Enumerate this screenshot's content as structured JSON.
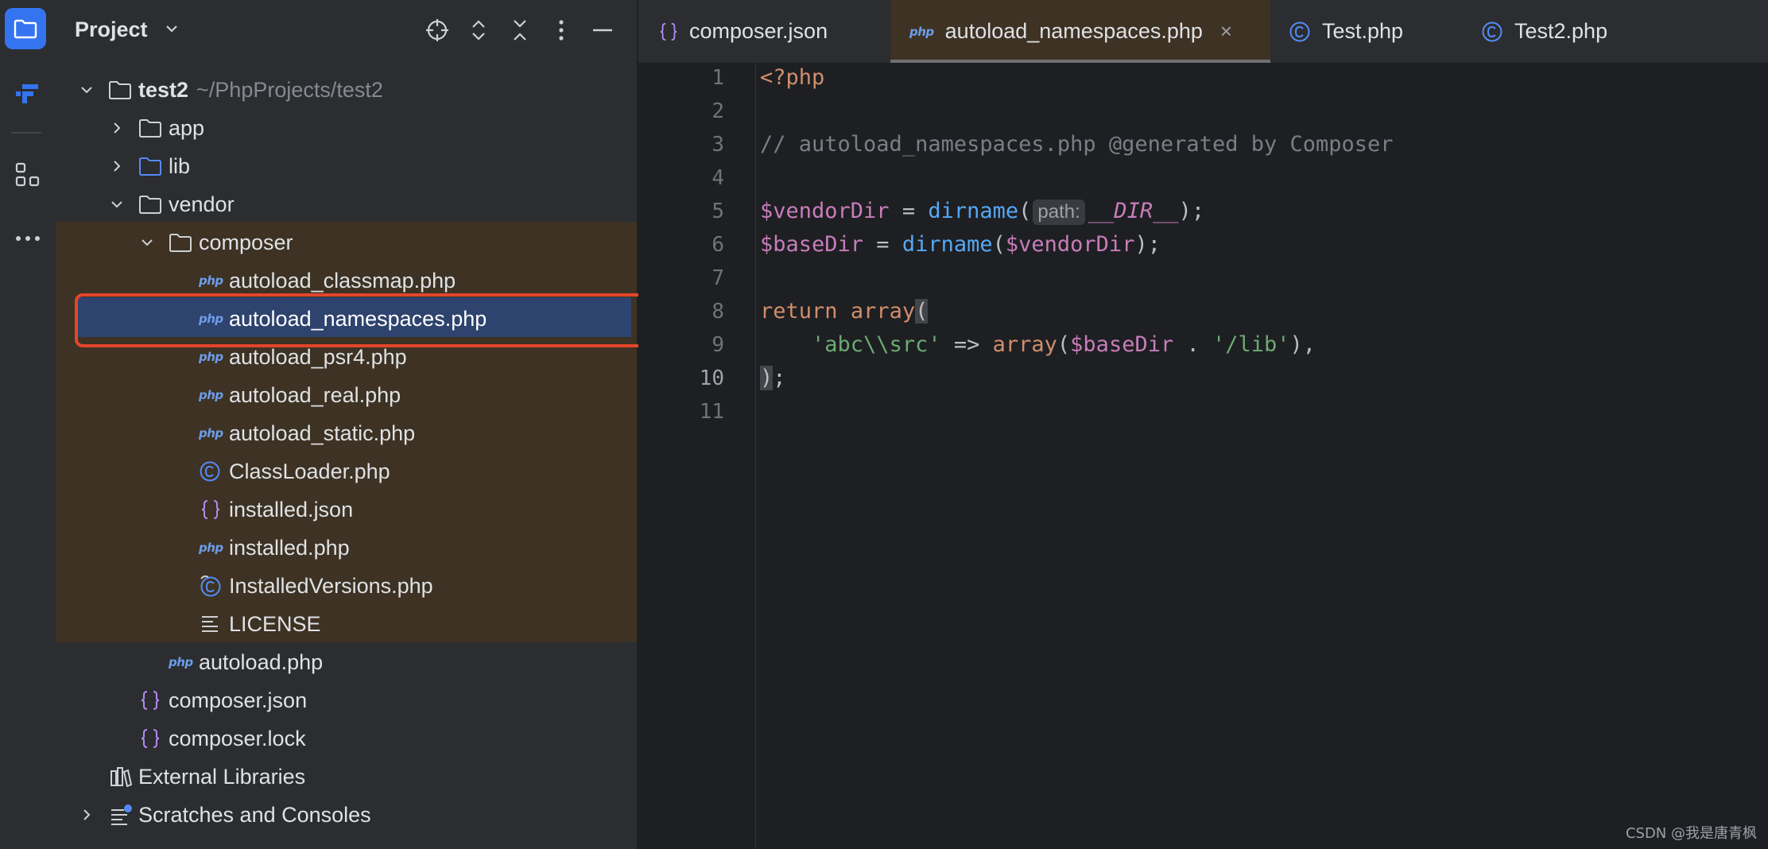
{
  "project": {
    "title": "Project",
    "tree": {
      "root": {
        "label": "test2",
        "path": "~/PhpProjects/test2"
      },
      "app": "app",
      "lib": "lib",
      "vendor": "vendor",
      "composer": "composer",
      "composer_files": [
        "autoload_classmap.php",
        "autoload_namespaces.php",
        "autoload_psr4.php",
        "autoload_real.php",
        "autoload_static.php",
        "ClassLoader.php",
        "installed.json",
        "installed.php",
        "InstalledVersions.php",
        "LICENSE"
      ],
      "vendor_autoload": "autoload.php",
      "root_files": [
        "composer.json",
        "composer.lock"
      ],
      "external_libraries": "External Libraries",
      "scratches": "Scratches and Consoles"
    }
  },
  "tabs": [
    {
      "label": "composer.json",
      "icon": "json-icon",
      "active": false
    },
    {
      "label": "autoload_namespaces.php",
      "icon": "php-file-icon",
      "active": true
    },
    {
      "label": "Test.php",
      "icon": "class-icon",
      "active": false
    },
    {
      "label": "Test2.php",
      "icon": "class-icon",
      "active": false
    }
  ],
  "php_tag": "php",
  "editor": {
    "line_numbers": [
      "1",
      "2",
      "3",
      "4",
      "5",
      "6",
      "7",
      "8",
      "9",
      "10",
      "11"
    ],
    "current_line": 10,
    "tokens": {
      "open_tag": "<?php",
      "comment": "// autoload_namespaces.php @generated by Composer",
      "vendor_dir_var": "$vendorDir",
      "assign": " = ",
      "dirname": "dirname",
      "paren_open": "(",
      "hint_label": "path:",
      "dir_const": "__DIR__",
      "paren_close_semi": ");",
      "base_dir_var": "$baseDir",
      "return_kw": "return",
      "array_kw": "array",
      "namespace_key": "'abc\\\\src'",
      "arrow": " => ",
      "concat": " . ",
      "lib_str": "'/lib'",
      "close_comma": "),",
      "close_paren": ")",
      "semicolon": ";"
    }
  },
  "watermark": "CSDN @我是唐青枫"
}
